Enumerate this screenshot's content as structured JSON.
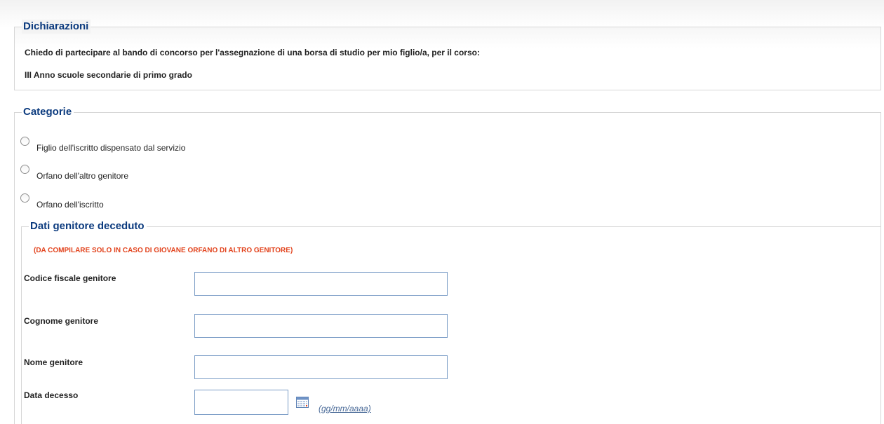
{
  "dichiarazioni": {
    "legend": "Dichiarazioni",
    "line1": "Chiedo di partecipare al bando di concorso per l'assegnazione di una borsa di studio per mio figlio/a, per il corso:",
    "line2": "III Anno scuole secondarie di primo grado"
  },
  "categorie": {
    "legend": "Categorie",
    "options": [
      {
        "label": "Figlio dell'iscritto dispensato dal servizio",
        "selected": false
      },
      {
        "label": "Orfano dell'altro genitore",
        "selected": false
      },
      {
        "label": "Orfano dell'iscritto",
        "selected": false
      }
    ]
  },
  "dati_genitore": {
    "legend": "Dati genitore deceduto",
    "warning": "(DA COMPILARE SOLO IN CASO DI GIOVANE ORFANO DI ALTRO GENITORE)",
    "warning_color": "#e2431d",
    "fields": {
      "codice_fiscale": {
        "label": "Codice fiscale genitore",
        "value": ""
      },
      "cognome": {
        "label": "Cognome genitore",
        "value": ""
      },
      "nome": {
        "label": "Nome genitore",
        "value": ""
      },
      "data_decesso": {
        "label": "Data decesso",
        "value": "",
        "hint": "(gg/mm/aaaa)",
        "icon": "calendar-icon"
      }
    }
  },
  "colors": {
    "legend_text": "#0b3a7e",
    "input_border": "#7a9cc6",
    "fieldset_border": "#d6d6d6"
  }
}
